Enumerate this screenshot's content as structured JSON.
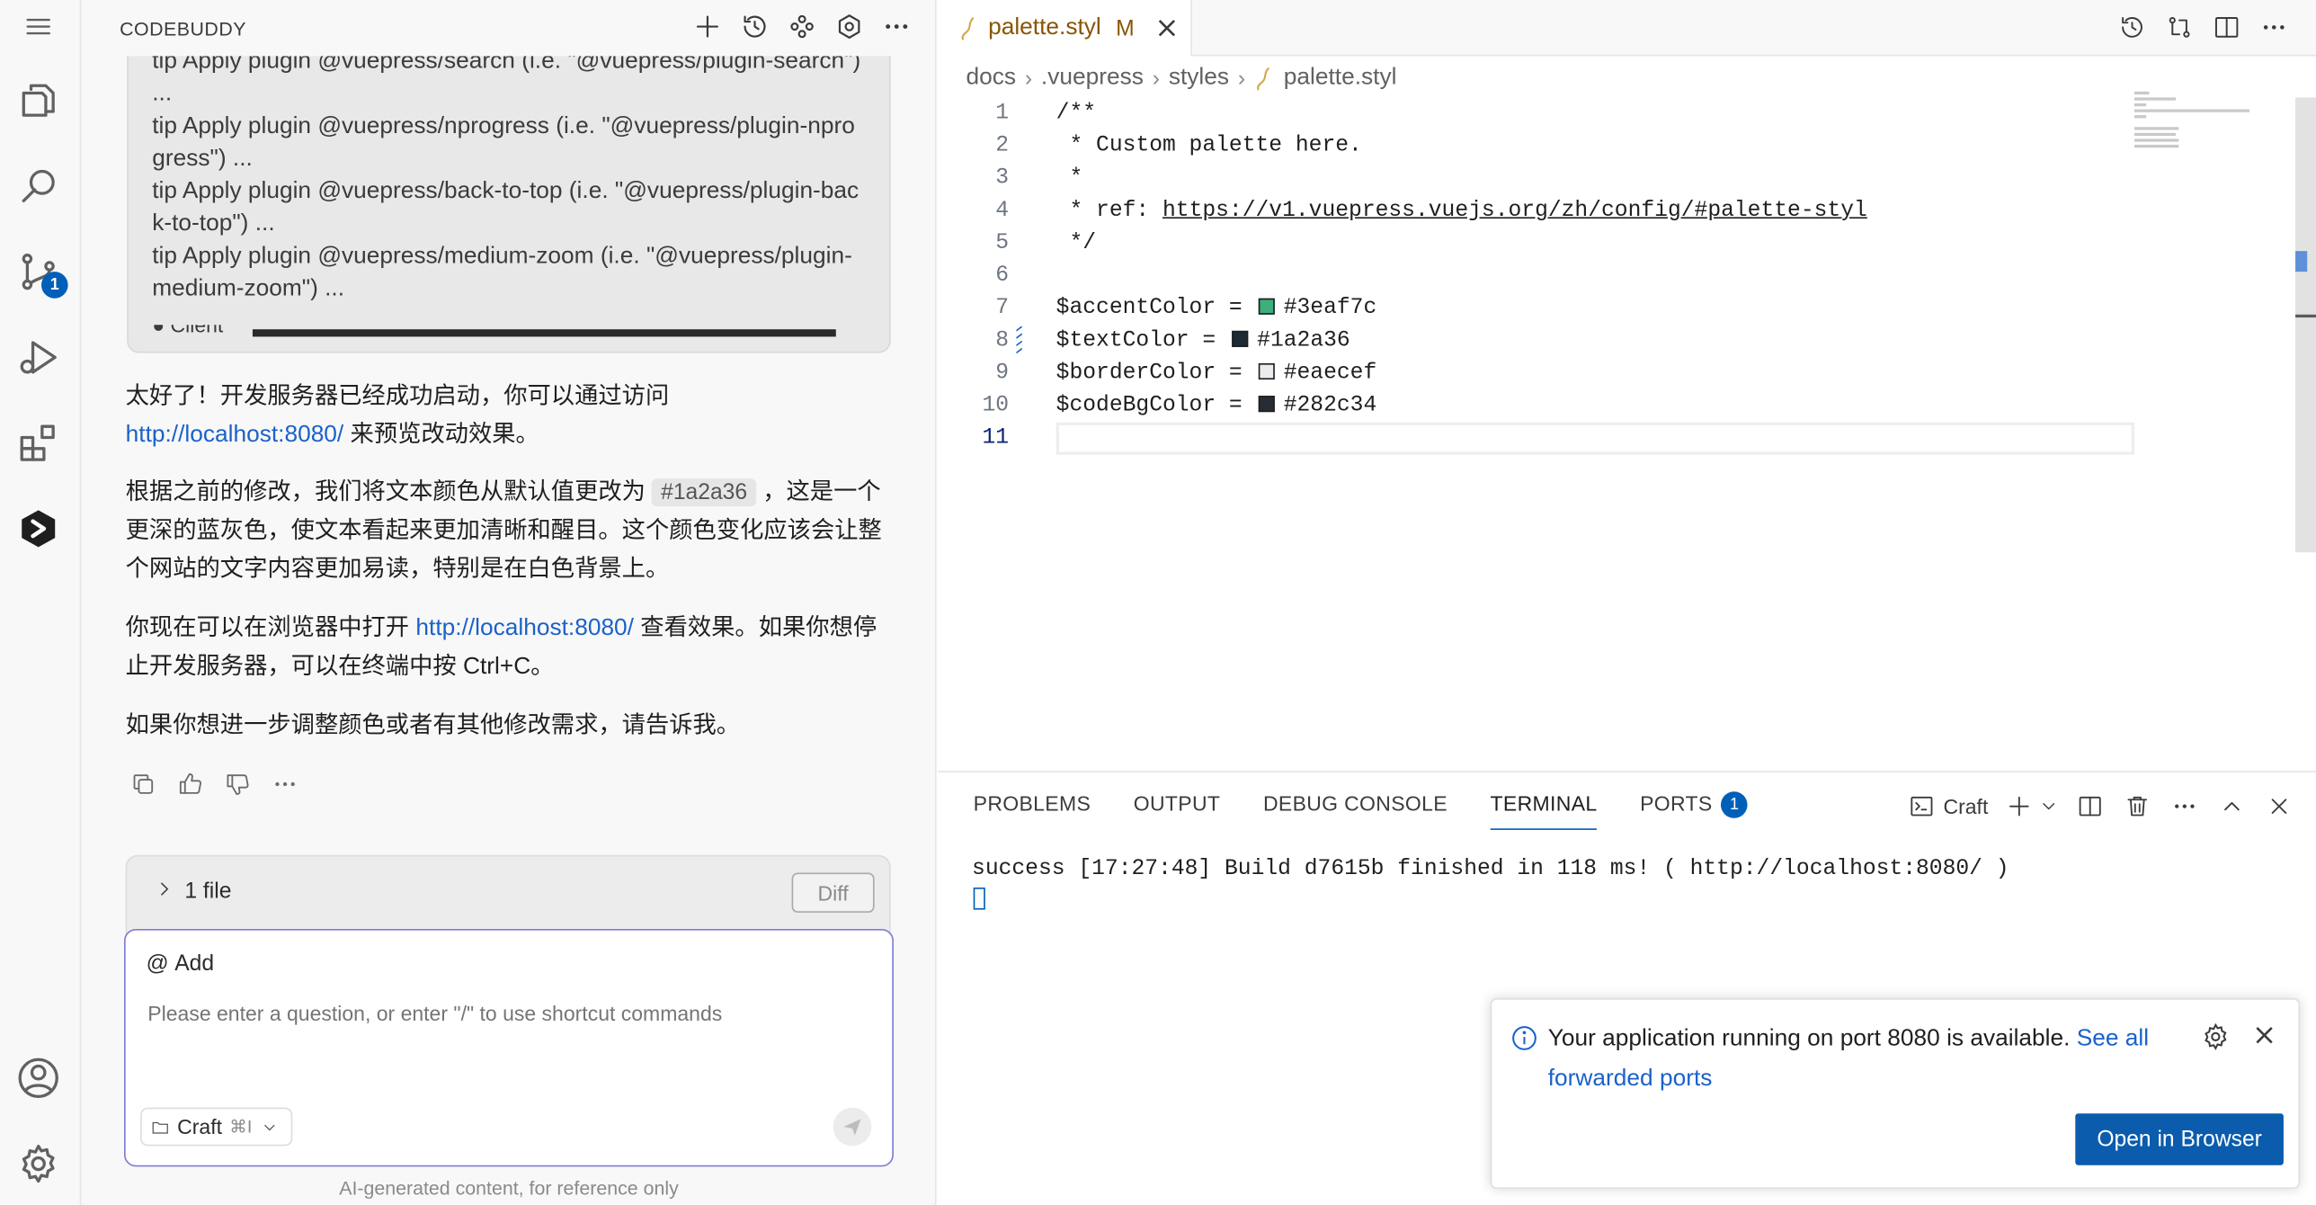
{
  "activity_bar": {
    "items": [
      {
        "name": "explorer",
        "icon": "files-icon"
      },
      {
        "name": "search",
        "icon": "search-icon"
      },
      {
        "name": "source-control",
        "icon": "source-control-icon",
        "badge": "1"
      },
      {
        "name": "run-debug",
        "icon": "run-debug-icon"
      },
      {
        "name": "extensions",
        "icon": "extensions-icon"
      },
      {
        "name": "codebuddy",
        "icon": "codebuddy-logo-icon"
      }
    ],
    "bottom": [
      {
        "name": "accounts",
        "icon": "account-icon"
      },
      {
        "name": "manage",
        "icon": "gear-icon"
      }
    ]
  },
  "codebuddy": {
    "title": "CODEBUDDY",
    "log_lines": [
      "tip Apply plugin @vuepress/search (i.e. \"@vuepress/plugin-search\") ...",
      "tip Apply plugin @vuepress/nprogress (i.e. \"@vuepress/plugin-nprogress\") ...",
      "tip Apply plugin @vuepress/back-to-top (i.e. \"@vuepress/plugin-back-to-top\") ...",
      "tip Apply plugin @vuepress/medium-zoom (i.e. \"@vuepress/plugin-medium-zoom\") ..."
    ],
    "log_status": "● Client",
    "reply": {
      "p1_before": "太好了！开发服务器已经成功启动，你可以通过访问",
      "p1_link": "http://localhost:8080/",
      "p1_after": " 来预览改动效果。",
      "p2_before": "根据之前的修改，我们将文本颜色从默认值更改为 ",
      "p2_code": "#1a2a36",
      "p2_after": " ，这是一个更深的蓝灰色，使文本看起来更加清晰和醒目。这个颜色变化应该会让整个网站的文字内容更加易读，特别是在白色背景上。",
      "p3_before": "你现在可以在浏览器中打开 ",
      "p3_link": "http://localhost:8080/",
      "p3_after": " 查看效果。如果你想停止开发服务器，可以在终端中按 Ctrl+C。",
      "p4": "如果你想进一步调整颜色或者有其他修改需求，请告诉我。"
    },
    "files_label": "1 file",
    "diff_label": "Diff",
    "input": {
      "add_label": "Add",
      "placeholder": "Please enter a question, or enter \"/\" to use shortcut commands",
      "mode_label": "Craft",
      "mode_shortcut": "⌘I"
    },
    "disclaimer": "AI-generated content, for reference only"
  },
  "editor": {
    "tab": {
      "name": "palette.styl",
      "status": "M"
    },
    "breadcrumb": [
      "docs",
      ".vuepress",
      "styles",
      "palette.styl"
    ],
    "active_line": "11",
    "lines": [
      {
        "n": "1",
        "text": "/**"
      },
      {
        "n": "2",
        "text": " * Custom palette here."
      },
      {
        "n": "3",
        "text": " *"
      },
      {
        "n": "4",
        "text": " * ref: ",
        "link": "https://v1.vuepress.vuejs.org/zh/config/#palette-styl"
      },
      {
        "n": "5",
        "text": " */"
      },
      {
        "n": "6",
        "text": ""
      },
      {
        "n": "7",
        "text": "$accentColor = ",
        "color": "#3eaf7c"
      },
      {
        "n": "8",
        "text": "$textColor = ",
        "color": "#1a2a36"
      },
      {
        "n": "9",
        "text": "$borderColor = ",
        "color": "#eaecef"
      },
      {
        "n": "10",
        "text": "$codeBgColor = ",
        "color": "#282c34"
      },
      {
        "n": "11",
        "text": ""
      }
    ]
  },
  "panel": {
    "tabs": [
      {
        "label": "PROBLEMS"
      },
      {
        "label": "OUTPUT"
      },
      {
        "label": "DEBUG CONSOLE"
      },
      {
        "label": "TERMINAL",
        "active": true
      },
      {
        "label": "PORTS",
        "badge": "1"
      }
    ],
    "terminal_name": "Craft",
    "output": "success [17:27:48] Build d7615b finished in 118 ms! ( http://localhost:8080/ )"
  },
  "notification": {
    "message": "Your application running on port 8080 is available. ",
    "link": "See all forwarded ports",
    "button": "Open in Browser"
  },
  "colors": {
    "accent": "#005fb8",
    "link": "#1a62c9",
    "modified_tab": "#895503",
    "input_border": "#7f7bd6"
  }
}
